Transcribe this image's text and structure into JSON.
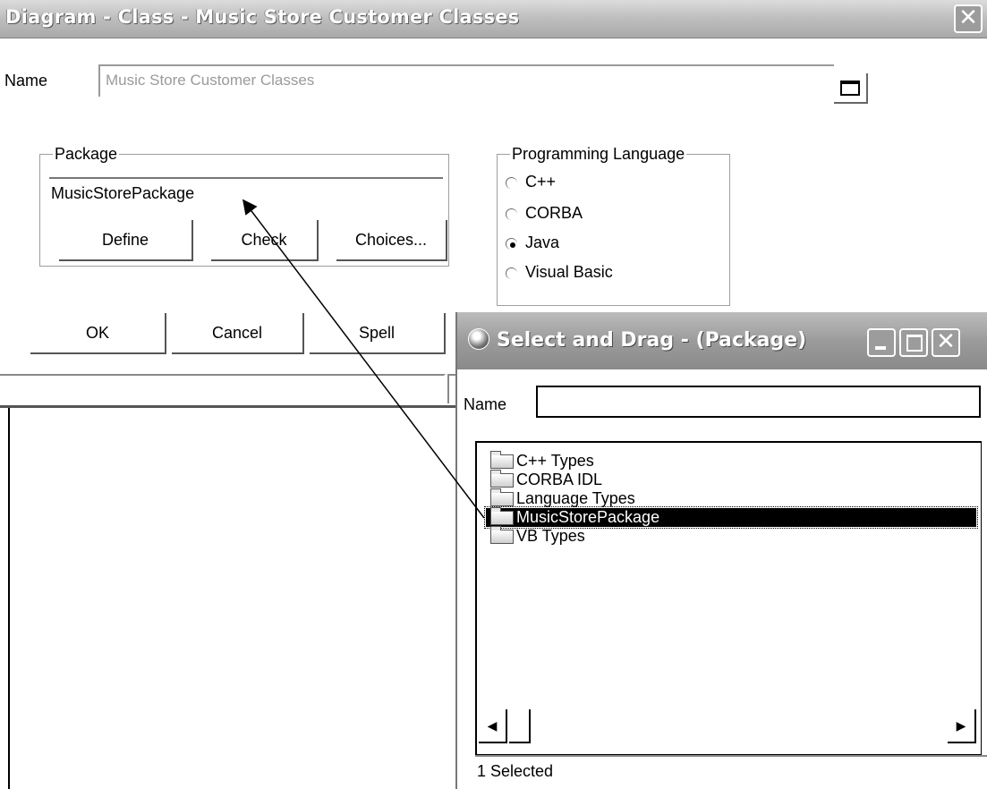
{
  "main_dialog": {
    "title": "Diagram - Class - Music Store Customer Classes",
    "name_label": "Name",
    "name_value": "Music Store Customer Classes",
    "package_group": {
      "legend": "Package",
      "value": "MusicStorePackage",
      "buttons": {
        "define": "Define",
        "check": "Check",
        "choices": "Choices..."
      }
    },
    "language_group": {
      "legend": "Programming Language",
      "options": [
        "C++",
        "CORBA",
        "Java",
        "Visual Basic"
      ],
      "selected": "Java"
    },
    "buttons": {
      "ok": "OK",
      "cancel": "Cancel",
      "spell": "Spell"
    }
  },
  "select_drag": {
    "title": "Select and Drag - (Package)",
    "name_label": "Name",
    "name_value": "",
    "tree_items": [
      "C++ Types",
      "CORBA IDL",
      "Language Types",
      "MusicStorePackage",
      "VB Types"
    ],
    "selected_item": "MusicStorePackage",
    "status": "1 Selected"
  }
}
